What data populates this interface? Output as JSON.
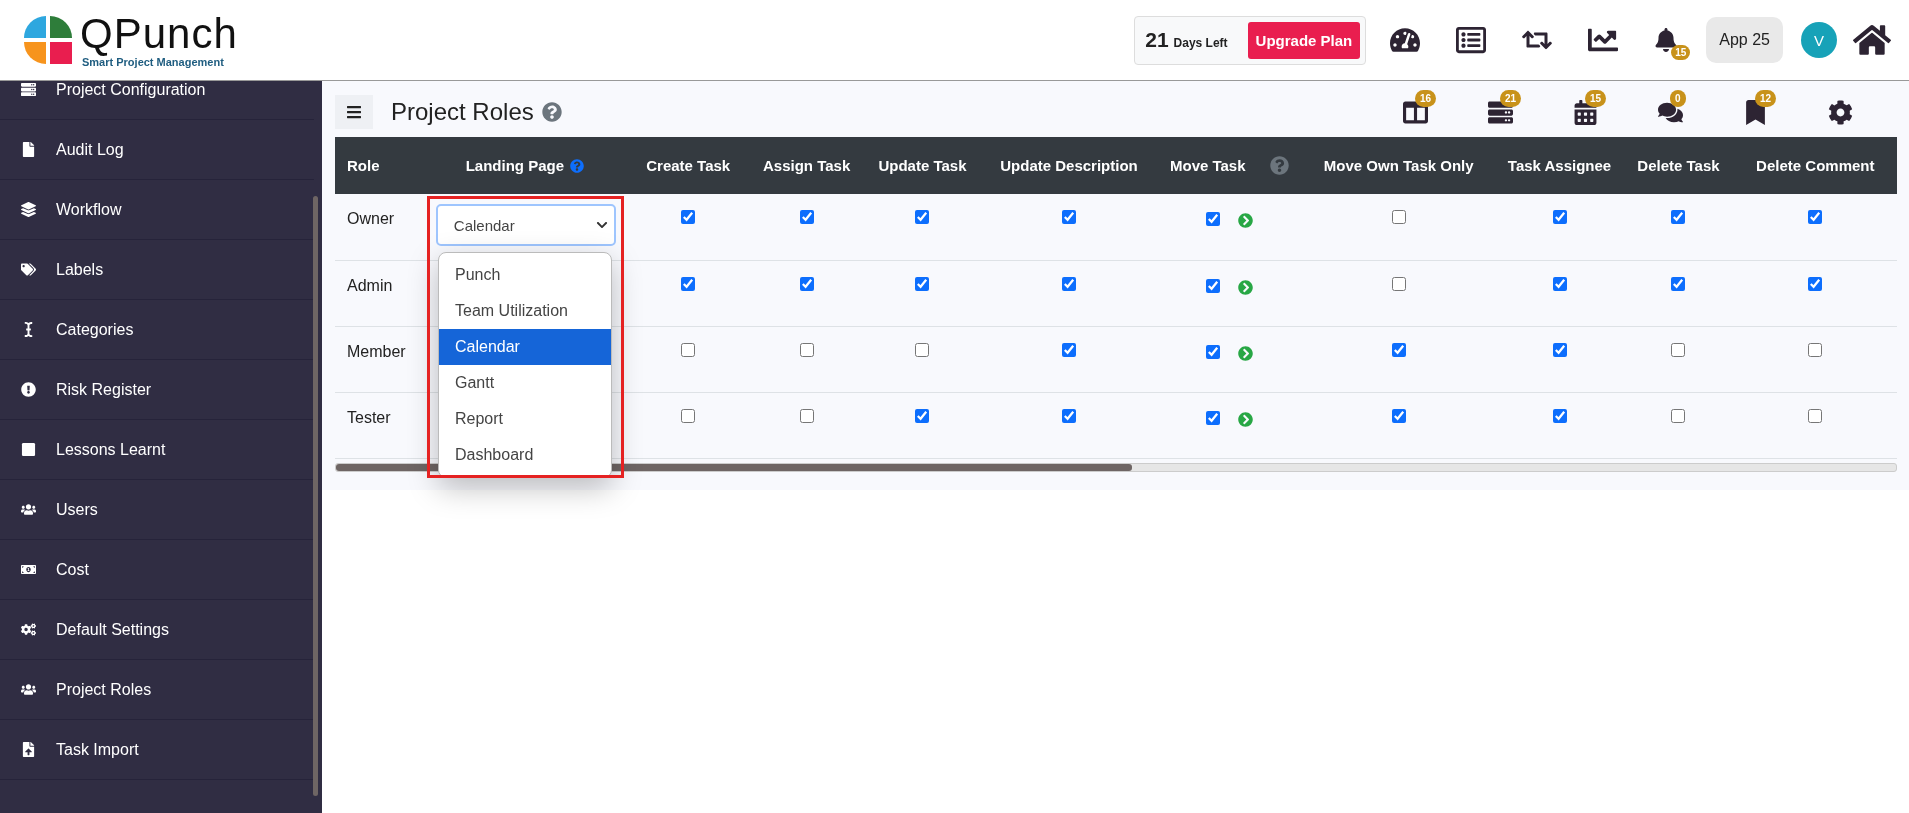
{
  "header": {
    "logo": {
      "name": "QPunch",
      "tagline": "Smart Project Management"
    },
    "trial": {
      "days": "21",
      "label": "Days Left"
    },
    "upgrade_button": "Upgrade Plan",
    "notification_count": "15",
    "app_button": "App 25",
    "avatar": "V"
  },
  "sidebar": {
    "items": [
      {
        "label": "Project Configuration",
        "selected": false
      },
      {
        "label": "Audit Log",
        "selected": false
      },
      {
        "label": "Workflow",
        "selected": false
      },
      {
        "label": "Labels",
        "selected": false
      },
      {
        "label": "Categories",
        "selected": false
      },
      {
        "label": "Risk Register",
        "selected": false
      },
      {
        "label": "Lessons Learnt",
        "selected": false
      },
      {
        "label": "Users",
        "selected": false
      },
      {
        "label": "Cost",
        "selected": false
      },
      {
        "label": "Default Settings",
        "selected": false
      },
      {
        "label": "Project Roles",
        "selected": false
      },
      {
        "label": "Task Import",
        "selected": false
      }
    ]
  },
  "page": {
    "title": "Project Roles",
    "toolbar_badges": [
      "16",
      "21",
      "15",
      "0",
      "12"
    ]
  },
  "table": {
    "columns": [
      {
        "label": "Role",
        "kind": "role"
      },
      {
        "label": "Landing Page",
        "kind": "landing",
        "help": true
      },
      {
        "label": "Create Task",
        "kind": "check"
      },
      {
        "label": "Assign Task",
        "kind": "check"
      },
      {
        "label": "Update Task",
        "kind": "check"
      },
      {
        "label": "Update Description",
        "kind": "check"
      },
      {
        "label": "Move Task",
        "kind": "check",
        "help": true,
        "action": true
      },
      {
        "label": "Move Own Task Only",
        "kind": "check"
      },
      {
        "label": "Task Assignee",
        "kind": "check"
      },
      {
        "label": "Delete Task",
        "kind": "check"
      },
      {
        "label": "Delete Comment",
        "kind": "check"
      }
    ],
    "rows": [
      {
        "role": "Owner",
        "landing": "Calendar",
        "permissions": [
          true,
          true,
          true,
          true,
          true,
          false,
          true,
          true,
          true
        ]
      },
      {
        "role": "Admin",
        "permissions": [
          true,
          true,
          true,
          true,
          true,
          false,
          true,
          true,
          true
        ]
      },
      {
        "role": "Member",
        "permissions": [
          false,
          false,
          false,
          true,
          true,
          true,
          true,
          false,
          false
        ]
      },
      {
        "role": "Tester",
        "permissions": [
          false,
          false,
          true,
          true,
          true,
          true,
          true,
          false,
          false
        ]
      }
    ]
  },
  "dropdown": {
    "highlighted": true,
    "options": [
      {
        "label": "Punch",
        "selected": false
      },
      {
        "label": "Team Utilization",
        "selected": false
      },
      {
        "label": "Calendar",
        "selected": true
      },
      {
        "label": "Gantt",
        "selected": false
      },
      {
        "label": "Report",
        "selected": false
      },
      {
        "label": "Dashboard",
        "selected": false
      }
    ]
  }
}
